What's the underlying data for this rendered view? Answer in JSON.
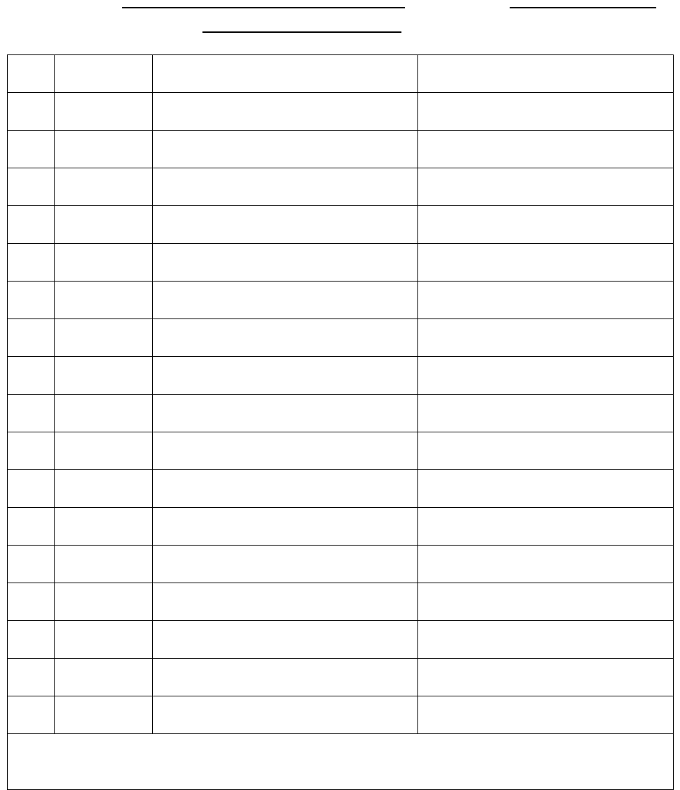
{
  "header": {
    "line1": "",
    "line2": "",
    "line3": ""
  },
  "table": {
    "rows": [
      {
        "col1": "",
        "col2": "",
        "col3": "",
        "col4": ""
      },
      {
        "col1": "",
        "col2": "",
        "col3": "",
        "col4": ""
      },
      {
        "col1": "",
        "col2": "",
        "col3": "",
        "col4": ""
      },
      {
        "col1": "",
        "col2": "",
        "col3": "",
        "col4": ""
      },
      {
        "col1": "",
        "col2": "",
        "col3": "",
        "col4": ""
      },
      {
        "col1": "",
        "col2": "",
        "col3": "",
        "col4": ""
      },
      {
        "col1": "",
        "col2": "",
        "col3": "",
        "col4": ""
      },
      {
        "col1": "",
        "col2": "",
        "col3": "",
        "col4": ""
      },
      {
        "col1": "",
        "col2": "",
        "col3": "",
        "col4": ""
      },
      {
        "col1": "",
        "col2": "",
        "col3": "",
        "col4": ""
      },
      {
        "col1": "",
        "col2": "",
        "col3": "",
        "col4": ""
      },
      {
        "col1": "",
        "col2": "",
        "col3": "",
        "col4": ""
      },
      {
        "col1": "",
        "col2": "",
        "col3": "",
        "col4": ""
      },
      {
        "col1": "",
        "col2": "",
        "col3": "",
        "col4": ""
      },
      {
        "col1": "",
        "col2": "",
        "col3": "",
        "col4": ""
      },
      {
        "col1": "",
        "col2": "",
        "col3": "",
        "col4": ""
      },
      {
        "col1": "",
        "col2": "",
        "col3": "",
        "col4": ""
      },
      {
        "col1": "",
        "col2": "",
        "col3": "",
        "col4": ""
      }
    ],
    "footer": ""
  }
}
